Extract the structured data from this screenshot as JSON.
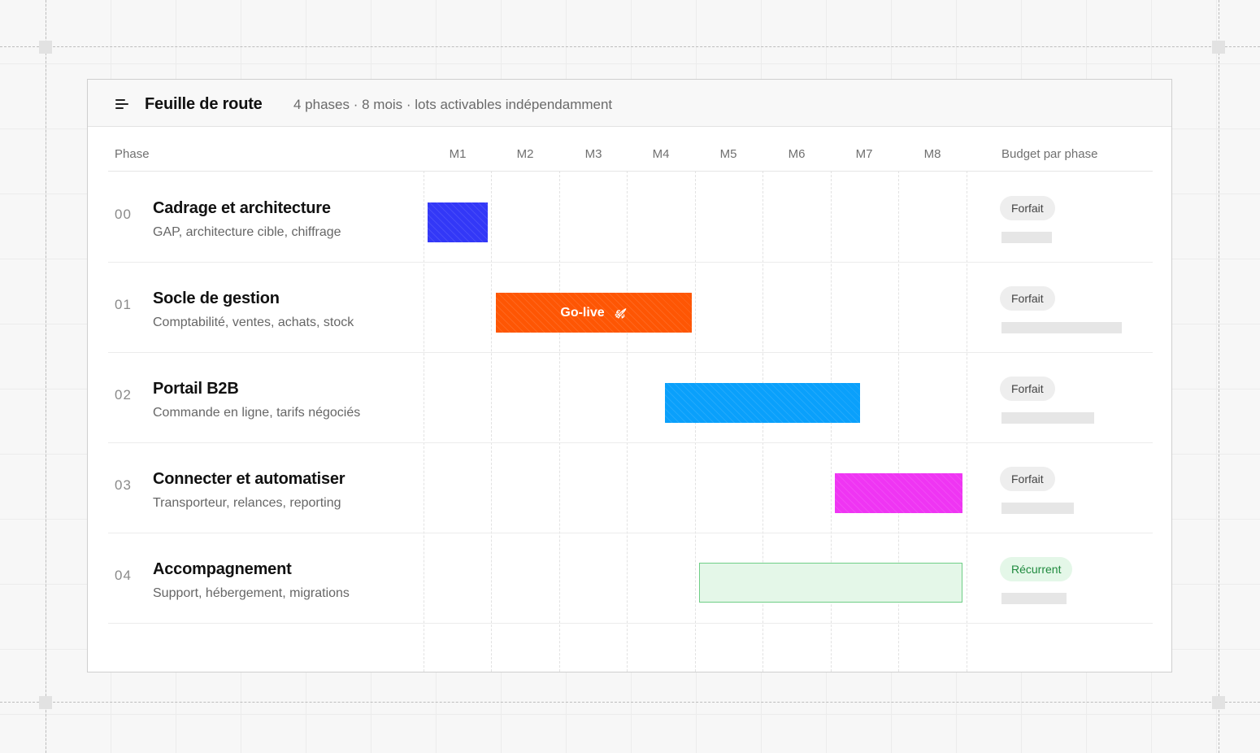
{
  "header": {
    "title": "Feuille de route",
    "subtitle": "4 phases · 8 mois · lots activables indépendamment",
    "menu_icon": "menu-icon"
  },
  "columns": {
    "phase": "Phase",
    "months": [
      "M1",
      "M2",
      "M3",
      "M4",
      "M5",
      "M6",
      "M7",
      "M8"
    ],
    "budget": "Budget par phase"
  },
  "phases": [
    {
      "num": "00",
      "title": "Cadrage et architecture",
      "desc": "GAP, architecture cible, chiffrage",
      "badge": "Forfait",
      "color": "#3338f7",
      "budget_level": 0.42
    },
    {
      "num": "01",
      "title": "Socle de gestion",
      "desc": "Comptabilité, ventes, achats, stock",
      "badge": "Forfait",
      "color": "#fe5604",
      "bar_label": "Go-live",
      "bar_icon": "rocket-icon",
      "budget_level": 1.0
    },
    {
      "num": "02",
      "title": "Portail B2B",
      "desc": "Commande en ligne, tarifs négociés",
      "badge": "Forfait",
      "color": "#0aa0fb",
      "budget_level": 0.77
    },
    {
      "num": "03",
      "title": "Connecter et automatiser",
      "desc": "Transporteur, relances, reporting",
      "badge": "Forfait",
      "color": "#ef35f3",
      "budget_level": 0.6
    },
    {
      "num": "04",
      "title": "Accompagnement",
      "desc": "Support, hébergement, migrations",
      "badge": "Récurrent",
      "color": "#e4f7e8",
      "border_color": "#6fce86",
      "budget_level": 0.54
    }
  ]
}
